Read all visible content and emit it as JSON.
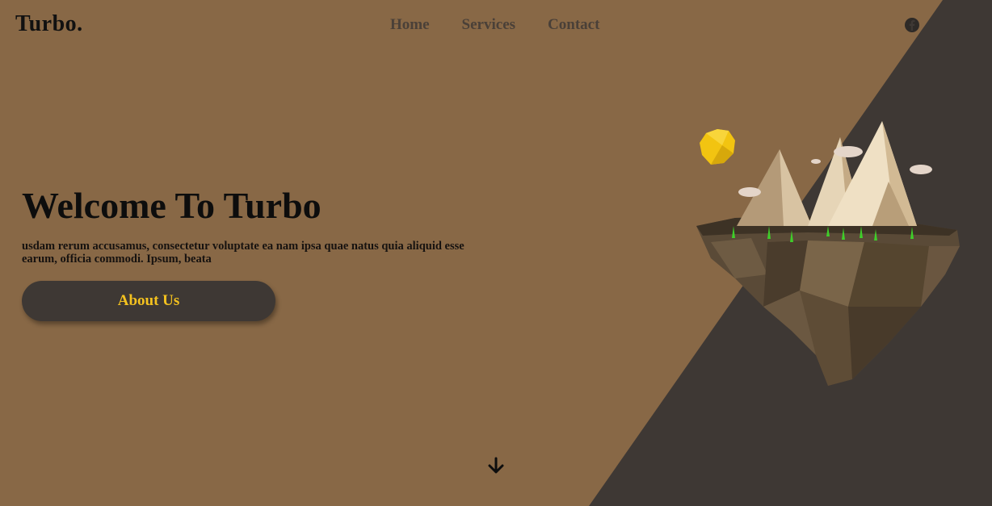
{
  "brand": {
    "logo": "Turbo."
  },
  "nav": {
    "items": [
      {
        "label": "Home"
      },
      {
        "label": "Services"
      },
      {
        "label": "Contact"
      }
    ]
  },
  "social": {
    "icon": "facebook-icon"
  },
  "hero": {
    "title": "Welcome To Turbo",
    "text": "usdam rerum accusamus, consectetur voluptate ea nam ipsa quae natus quia aliquid esse earum, officia commodi. Ipsum, beata",
    "button_label": "About Us"
  },
  "scroll": {
    "icon": "arrow-down-icon"
  },
  "colors": {
    "background": "#886846",
    "dark_panel": "#3e3834",
    "accent": "#f4c21f",
    "text_dark": "#111111"
  }
}
